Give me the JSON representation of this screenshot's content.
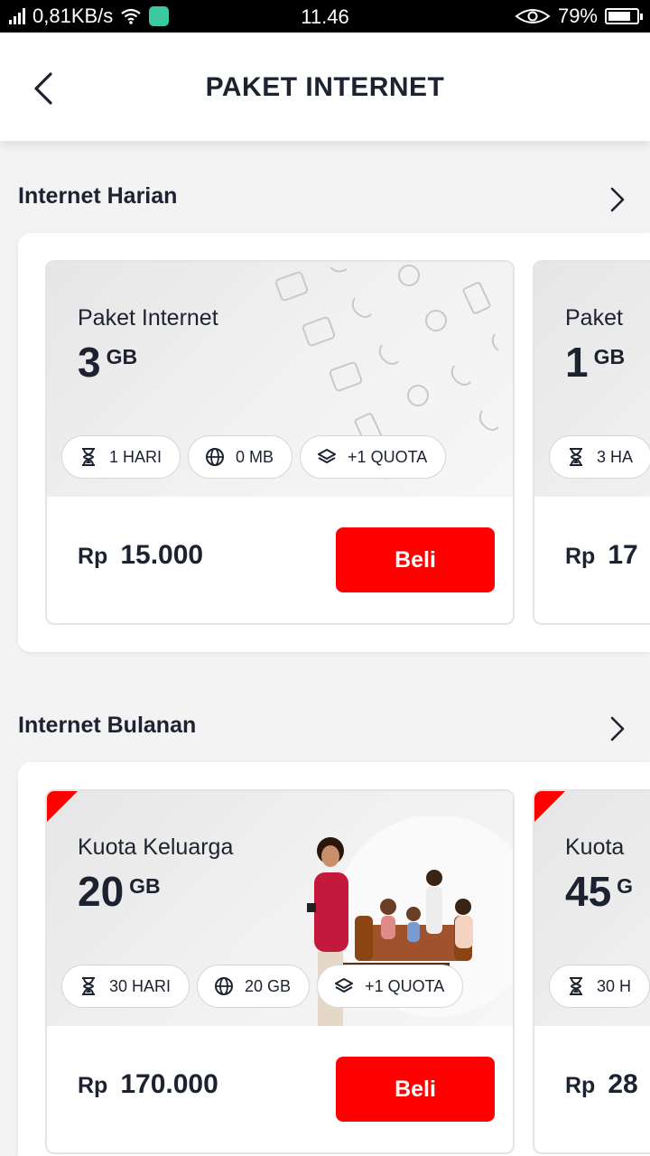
{
  "status_bar": {
    "speed": "0,81KB/s",
    "time": "11.46",
    "battery": "79%",
    "battery_level": 0.79
  },
  "header": {
    "title": "PAKET INTERNET"
  },
  "sections": [
    {
      "title": "Internet Harian",
      "cards": [
        {
          "name": "Paket Internet",
          "quota_num": "3",
          "quota_unit": "GB",
          "pills": [
            {
              "icon": "hourglass-icon",
              "text": "1 HARI"
            },
            {
              "icon": "globe-icon",
              "text": "0 MB"
            },
            {
              "icon": "layers-icon",
              "text": "+1 QUOTA"
            }
          ],
          "currency": "Rp",
          "price": "15.000",
          "buy_label": "Beli"
        },
        {
          "name": "Paket",
          "quota_num": "1",
          "quota_unit": "GB",
          "pills": [
            {
              "icon": "hourglass-icon",
              "text": "3 HA"
            }
          ],
          "currency": "Rp",
          "price": "17"
        }
      ]
    },
    {
      "title": "Internet Bulanan",
      "cards": [
        {
          "name": "Kuota Keluarga",
          "quota_num": "20",
          "quota_unit": "GB",
          "pills": [
            {
              "icon": "hourglass-icon",
              "text": "30 HARI"
            },
            {
              "icon": "globe-icon",
              "text": "20 GB"
            },
            {
              "icon": "layers-icon",
              "text": "+1 QUOTA"
            }
          ],
          "currency": "Rp",
          "price": "170.000",
          "buy_label": "Beli"
        },
        {
          "name": "Kuota",
          "quota_num": "45",
          "quota_unit": "G",
          "pills": [
            {
              "icon": "hourglass-icon",
              "text": "30 H"
            }
          ],
          "currency": "Rp",
          "price": "28"
        }
      ]
    }
  ],
  "colors": {
    "accent": "#ff0000",
    "text": "#1c2230",
    "background": "#f3f3f3"
  }
}
